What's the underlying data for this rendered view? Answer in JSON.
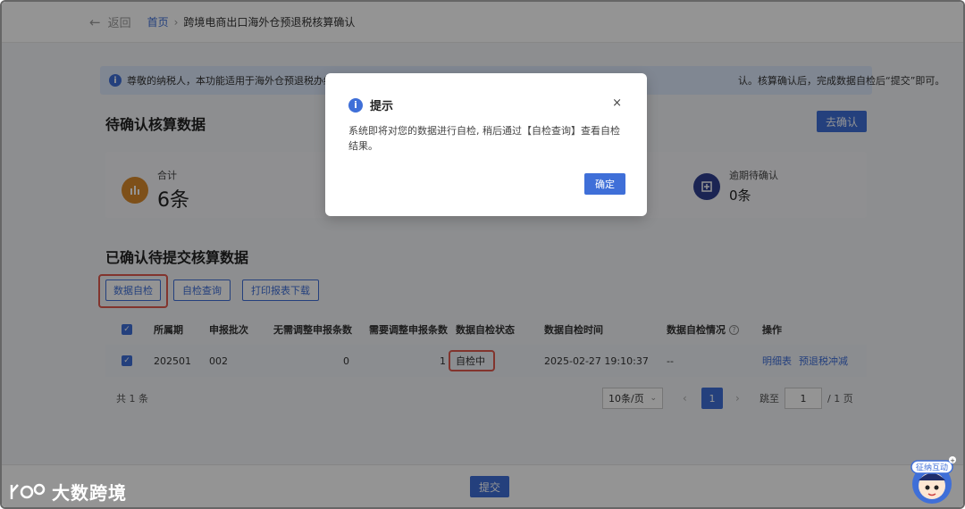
{
  "header": {
    "back_label": "返回",
    "crumb_home": "首页",
    "crumb_sep": "›",
    "crumb_current": "跨境电商出口海外仓预退税核算确认"
  },
  "notice": {
    "text_left": "尊敬的纳税人，本功能适用于海外仓预退税办结后",
    "text_right": "认。核算确认后，完成数据自检后“提交”即可。"
  },
  "pending": {
    "title": "待确认核算数据",
    "confirm_button": "去确认",
    "stat_total_label": "合计",
    "stat_total_value": "6条",
    "stat_overdue_label": "逾期待确认",
    "stat_overdue_value": "0条"
  },
  "confirmed": {
    "title": "已确认待提交核算数据",
    "btn_self_check": "数据自检",
    "btn_check_query": "自检查询",
    "btn_print": "打印报表下载"
  },
  "table": {
    "headers": [
      "所属期",
      "申报批次",
      "无需调整申报条数",
      "需要调整申报条数",
      "数据自检状态",
      "数据自检时间",
      "数据自检情况",
      "操作"
    ],
    "rows": [
      {
        "period": "202501",
        "batch": "002",
        "no_adjust": "0",
        "need_adjust": "1",
        "status": "自检中",
        "check_time": "2025-02-27 19:10:37",
        "situation": "--",
        "op_detail": "明细表",
        "op_offset": "预退税冲减"
      }
    ]
  },
  "pagination": {
    "total": "共 1 条",
    "page_size": "10条/页",
    "current_page": "1",
    "jump_label": "跳至",
    "jump_value": "1",
    "total_pages": "/ 1 页"
  },
  "footer": {
    "submit": "提交"
  },
  "modal": {
    "title": "提示",
    "close": "×",
    "body": "系统即将对您的数据进行自检, 稍后通过【自检查询】查看自检结果。",
    "ok": "确定"
  },
  "watermark": {
    "brand_text": "大数跨境",
    "badge_text": "征纳互动"
  },
  "colors": {
    "primary": "#3f6fd8",
    "highlight": "#e05a4e",
    "total_icon": "#d98a2b",
    "overdue_icon": "#2f3f8f"
  }
}
